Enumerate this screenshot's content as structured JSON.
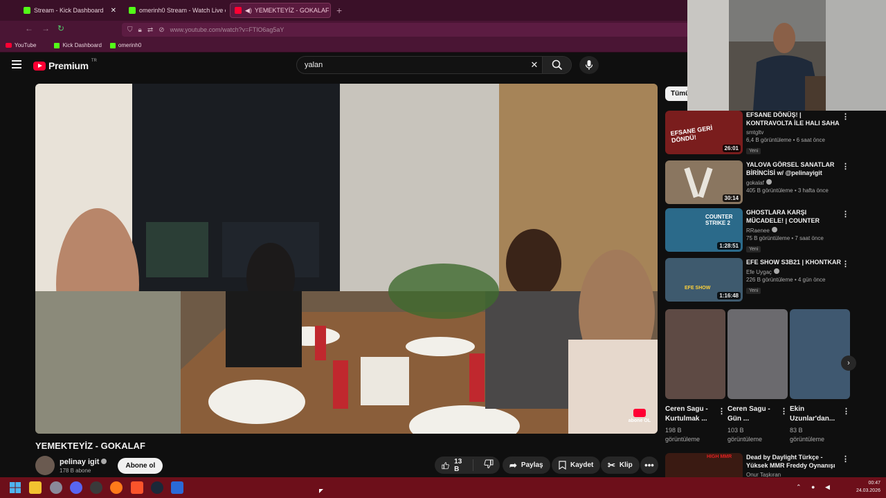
{
  "browser": {
    "tabs": [
      {
        "title": "Stream - Kick Dashboard",
        "favicon": "kick-icon"
      },
      {
        "title": "omerinh0 Stream - Watch Live o",
        "favicon": "kick-icon"
      },
      {
        "title": "YEMEKTEYİZ - GOKALAF - Y",
        "favicon": "youtube-icon",
        "active": true
      }
    ],
    "url": "www.youtube.com/watch?v=FTlO6ag5aY",
    "bookmarks": [
      "YouTube",
      "Kick Dashboard",
      "omerinh0"
    ]
  },
  "masthead": {
    "logo_text": "Premium",
    "region": "TR",
    "search_query": "yalan"
  },
  "video": {
    "title": "YEMEKTEYİZ - GOKALAF",
    "channel": "pelinay igit",
    "subscribers": "178 B abone",
    "subscribe_label": "Abone ol",
    "likes": "13 B",
    "share_label": "Paylaş",
    "save_label": "Kaydet",
    "clip_label": "Klip",
    "overlay_label": "abone OL"
  },
  "sidebar": {
    "chip": "Tümü",
    "recommendations": [
      {
        "title": "EFSANE DÖNÜŞ! | KONTRAVOLTA İLE HALI SAHA",
        "channel": "smtgltv",
        "stats": "6,4 B görüntüleme • 6 saat önce",
        "badge": "Yeni",
        "duration": "26:01",
        "thumb_color": "#7a1d1d",
        "thumb_text": "EFSANE GERİ DÖNDÜ!"
      },
      {
        "title": "YALOVA GÖRSEL SANATLAR BİRİNCİSİ w/ @pelinayigit",
        "channel": "gokalaf",
        "stats": "405 B görüntüleme • 3 hafta önce",
        "badge": "",
        "duration": "30:14",
        "thumb_color": "#8a7660",
        "thumb_text": ""
      },
      {
        "title": "GHOSTLARA KARŞI MÜCADELE! | COUNTER STRIK...",
        "channel": "RRaenee",
        "stats": "75 B görüntüleme • 7 saat önce",
        "badge": "Yeni",
        "duration": "1:28:51",
        "thumb_color": "#2b6a8a",
        "thumb_text": "COUNTER STRIKE 2"
      },
      {
        "title": "EFE SHOW S3B21 | KHONTKAR",
        "channel": "Efe Uygaç",
        "stats": "226 B görüntüleme • 4 gün önce",
        "badge": "Yeni",
        "duration": "1:16:48",
        "thumb_color": "#3e5a6e",
        "thumb_text": "EFE SHOW"
      }
    ],
    "shorts": [
      {
        "title": "Ceren Sagu - Kurtulmak ...",
        "views": "198 B görüntüleme",
        "thumb_color": "#5e4a44"
      },
      {
        "title": "Ceren Sagu - Gün ...",
        "views": "103 B görüntüleme",
        "thumb_color": "#6b6a6e"
      },
      {
        "title": "Ekin Uzunlar'dan...",
        "views": "83 B görüntüleme",
        "thumb_color": "#3f5870"
      }
    ],
    "last": {
      "title": "Dead by Daylight Türkçe - Yüksek MMR Freddy Oynanışı",
      "channel": "Onur Taşkıran",
      "thumb_text": "HIGH MMR"
    }
  },
  "taskbar": {
    "time": "00:47",
    "date": "24.03.2026"
  }
}
